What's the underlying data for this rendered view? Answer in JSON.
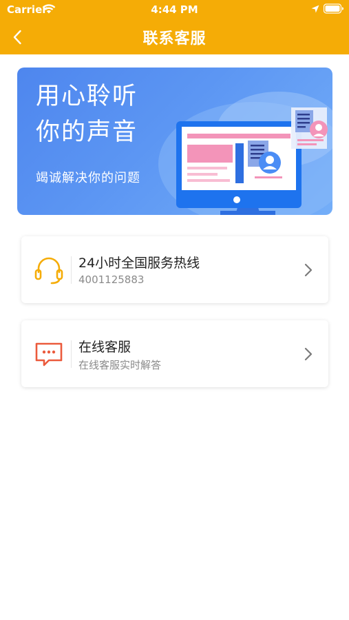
{
  "status_bar": {
    "carrier": "Carrier",
    "time": "4:44 PM"
  },
  "nav": {
    "title": "联系客服",
    "back_icon": "chevron-left-icon"
  },
  "banner": {
    "title_line1": "用心聆听",
    "title_line2": "你的声音",
    "subtitle": "竭诚解决你的问题"
  },
  "cards": [
    {
      "title": "24小时全国服务热线",
      "subtitle": "4001125883",
      "icon": "headset-icon",
      "icon_color": "#F5AC06"
    },
    {
      "title": "在线客服",
      "subtitle": "在线客服实时解答",
      "icon": "chat-bubble-icon",
      "icon_color": "#EB5A3C"
    }
  ],
  "colors": {
    "header": "#F5AC06",
    "banner_blue": "#4E86EE",
    "text_primary": "#222222",
    "text_secondary": "#8a8a8a"
  }
}
